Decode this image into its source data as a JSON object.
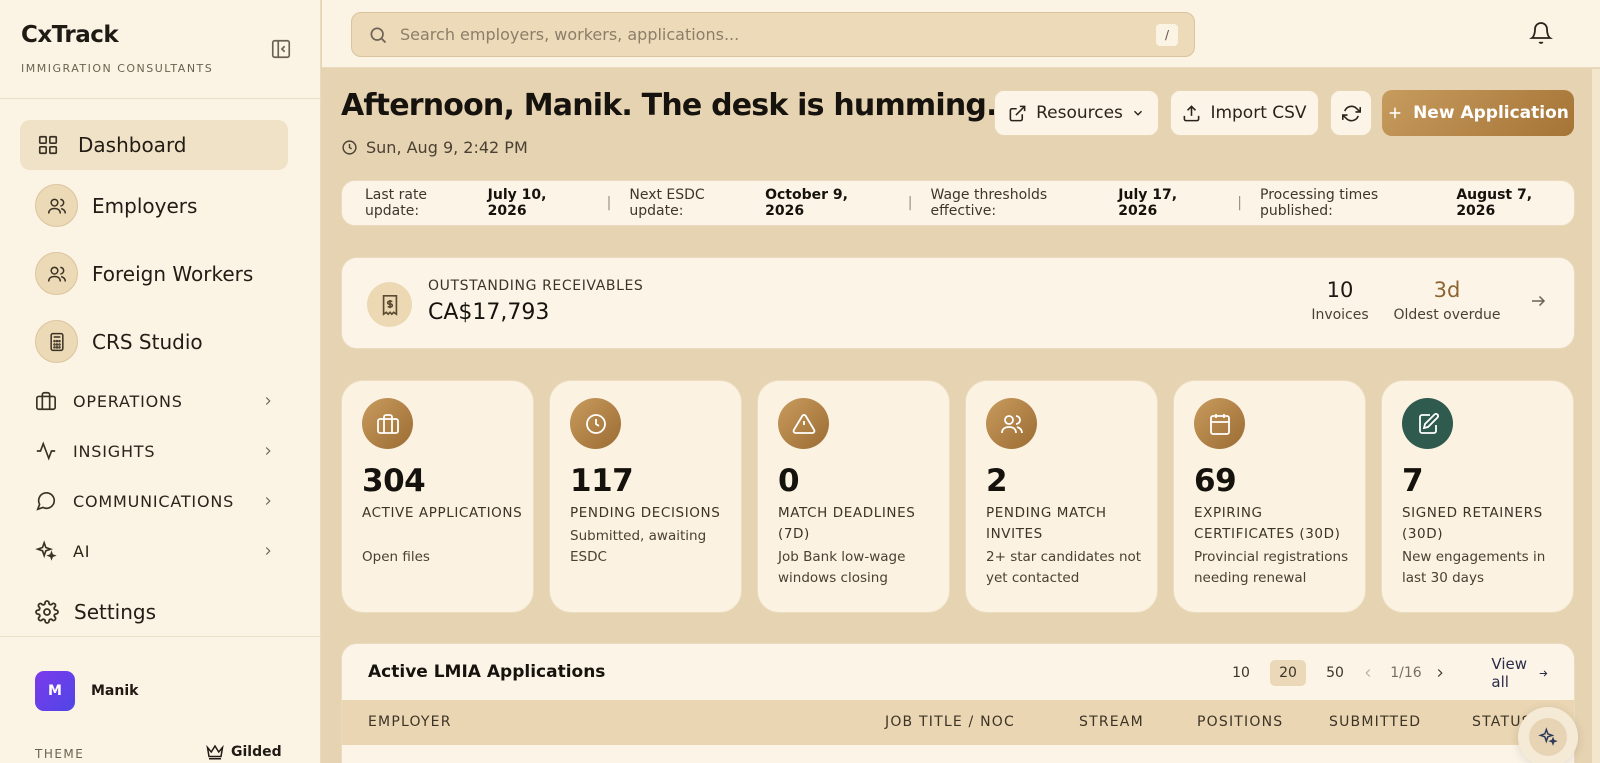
{
  "brand": {
    "name": "CxTrack",
    "subtitle": "IMMIGRATION CONSULTANTS"
  },
  "sidebar": {
    "items": [
      {
        "label": "Dashboard",
        "icon": "grid-icon",
        "active": true
      },
      {
        "label": "Employers",
        "icon": "users-icon"
      },
      {
        "label": "Foreign Workers",
        "icon": "users-icon"
      },
      {
        "label": "CRS Studio",
        "icon": "calculator-icon"
      }
    ],
    "groups": [
      {
        "label": "OPERATIONS",
        "icon": "briefcase-icon"
      },
      {
        "label": "INSIGHTS",
        "icon": "activity-icon"
      },
      {
        "label": "COMMUNICATIONS",
        "icon": "chat-bubble-icon"
      },
      {
        "label": "AI",
        "icon": "sparkles-icon"
      }
    ],
    "settings": "Settings",
    "user": {
      "initial": "M",
      "name": "Manik"
    },
    "theme": {
      "label": "THEME",
      "value": "Gilded"
    }
  },
  "search": {
    "placeholder": "Search employers, workers, applications...",
    "shortcut": "/"
  },
  "header": {
    "greeting": "Afternoon, Manik. The desk is humming.",
    "datetime": "Sun, Aug 9, 2:42 PM",
    "resources_label": "Resources",
    "import_label": "Import CSV",
    "new_label": "New Application"
  },
  "rates": [
    {
      "label": "Last rate update:",
      "value": "July 10, 2026"
    },
    {
      "label": "Next ESDC update:",
      "value": "October 9, 2026"
    },
    {
      "label": "Wage thresholds effective:",
      "value": "July 17, 2026"
    },
    {
      "label": "Processing times published:",
      "value": "August 7, 2026"
    }
  ],
  "receivables": {
    "label": "OUTSTANDING RECEIVABLES",
    "amount": "CA$17,793",
    "invoices_value": "10",
    "invoices_label": "Invoices",
    "overdue_value": "3d",
    "overdue_label": "Oldest overdue"
  },
  "stats": [
    {
      "value": "304",
      "title": "ACTIVE APPLICATIONS",
      "desc": "Open files",
      "icon": "briefcase-icon"
    },
    {
      "value": "117",
      "title": "PENDING DECISIONS",
      "desc": "Submitted, awaiting ESDC",
      "icon": "clock-icon"
    },
    {
      "value": "0",
      "title": "MATCH DEADLINES (7D)",
      "desc": "Job Bank low-wage windows closing",
      "icon": "warning-icon"
    },
    {
      "value": "2",
      "title": "PENDING MATCH INVITES",
      "desc": "2+ star candidates not yet contacted",
      "icon": "users-icon"
    },
    {
      "value": "69",
      "title": "EXPIRING CERTIFICATES (30D)",
      "desc": "Provincial registrations needing renewal",
      "icon": "calendar-icon"
    },
    {
      "value": "7",
      "title": "SIGNED RETAINERS (30D)",
      "desc": "New engagements in last 30 days",
      "icon": "signature-icon"
    }
  ],
  "table": {
    "title": "Active LMIA Applications",
    "page_sizes": [
      "10",
      "20",
      "50"
    ],
    "selected_page_size": "20",
    "page_indicator": "1/16",
    "view_all": "View all",
    "columns": [
      "EMPLOYER",
      "JOB TITLE / NOC",
      "STREAM",
      "POSITIONS",
      "SUBMITTED",
      "STATUS"
    ]
  },
  "colors": {
    "accent": "#b5854a",
    "sidebar_bg": "#fbf3e3",
    "main_bg": "#e6d3b1",
    "green_icon": "#2f5a4e"
  }
}
